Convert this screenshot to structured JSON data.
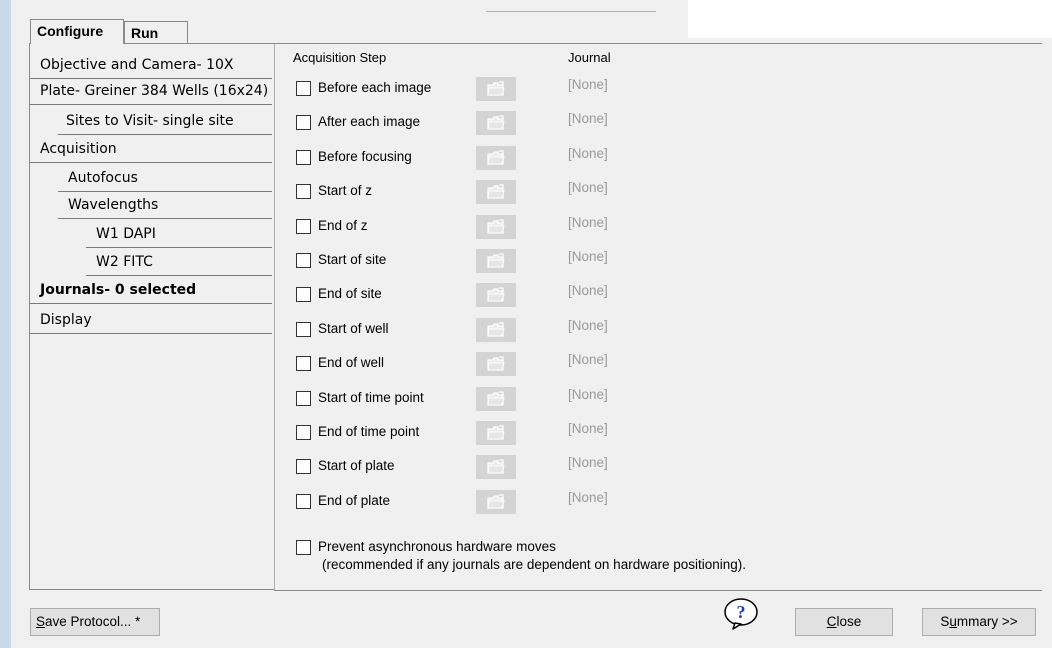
{
  "tabs": [
    {
      "label": "Configure",
      "active": true
    },
    {
      "label": "Run",
      "active": false
    }
  ],
  "nav": {
    "items": [
      {
        "label": "Objective and Camera- 10X"
      },
      {
        "label": "Plate- Greiner 384 Wells (16x24)"
      },
      {
        "label": "Sites to Visit- single site"
      },
      {
        "label": "Acquisition"
      },
      {
        "label": "Autofocus"
      },
      {
        "label": "Wavelengths"
      },
      {
        "label": "W1 DAPI"
      },
      {
        "label": "W2 FITC"
      },
      {
        "label": "Journals- 0 selected",
        "selected": true
      },
      {
        "label": "Display"
      }
    ]
  },
  "journals": {
    "header_step": "Acquisition Step",
    "header_journal": "Journal",
    "none_label": "[None]",
    "steps": [
      {
        "label": "Before each image",
        "checked": false
      },
      {
        "label": "After each image",
        "checked": false
      },
      {
        "label": "Before focusing",
        "checked": false
      },
      {
        "label": "Start of z",
        "checked": false
      },
      {
        "label": "End of z",
        "checked": false
      },
      {
        "label": "Start of site",
        "checked": false
      },
      {
        "label": "End of site",
        "checked": false
      },
      {
        "label": "Start of well",
        "checked": false
      },
      {
        "label": "End of well",
        "checked": false
      },
      {
        "label": "Start of time point",
        "checked": false
      },
      {
        "label": "End of time point",
        "checked": false
      },
      {
        "label": "Start of plate",
        "checked": false
      },
      {
        "label": "End of plate",
        "checked": false
      }
    ],
    "async_label_line1": "Prevent asynchronous hardware moves",
    "async_label_line2": "(recommended if any journals are dependent on hardware positioning)."
  },
  "footer": {
    "save_prefix": "S",
    "save_rest": "ave Protocol... *",
    "help_icon": "question-icon",
    "close_prefix": "C",
    "close_rest": "lose",
    "summary_prefix": "S",
    "summary_u": "u",
    "summary_rest": "mmary >>"
  },
  "colors": {
    "left_strip": "#c9d9ea",
    "window_bg": "#f0f0f0",
    "folder_button_bg": "#d4d4d4",
    "none_text": "#9a9a9a"
  }
}
